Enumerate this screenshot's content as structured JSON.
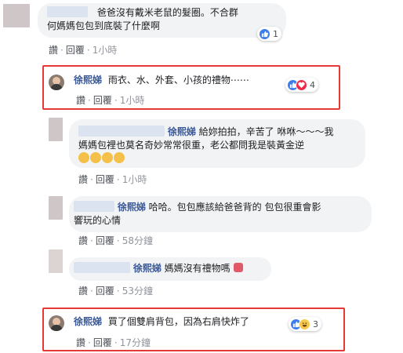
{
  "comments": [
    {
      "text_line1": "爸爸沒有戴米老鼠的髮圈。不合群",
      "text_line2": "何媽媽包包到底裝了什麼啊",
      "reaction_count": "1",
      "like_label": "讚",
      "reply_label": "回覆",
      "time": "1小時"
    },
    {
      "author": "徐熙娣",
      "text": "雨衣、水、外套、小孩的禮物⋯⋯",
      "reaction_count": "4",
      "like_label": "讚",
      "reply_label": "回覆",
      "time": "1小時"
    },
    {
      "author": "徐熙娣",
      "text_line1": "給妳拍拍，辛苦了 咻咻～～～我",
      "text_line2": "媽媽包裡也莫名奇妙常常很重，老公都問我是裝黃金逆",
      "like_label": "讚",
      "reply_label": "回覆",
      "time": "1小時"
    },
    {
      "author": "徐熙娣",
      "text_line1": "哈哈。包包應該給爸爸背的 包包很重會影",
      "text_line2": "響玩的心情",
      "like_label": "讚",
      "reply_label": "回覆",
      "time": "58分鐘"
    },
    {
      "author": "徐熙娣",
      "text": "媽媽沒有禮物嗎",
      "like_label": "讚",
      "reply_label": "回覆",
      "time": "53分鐘"
    },
    {
      "author": "徐熙娣",
      "text": "買了個雙肩背包，因為右肩快炸了",
      "reaction_count": "3",
      "like_label": "讚",
      "reply_label": "回覆",
      "time": "17分鐘"
    }
  ],
  "separator": "·",
  "colors": {
    "highlight_border": "#e53935",
    "author_link": "#385898",
    "bubble_bg": "#f2f3f5",
    "like_blue": "#3b7ded",
    "love_red": "#f0284a",
    "haha_yellow": "#f7c84a"
  }
}
